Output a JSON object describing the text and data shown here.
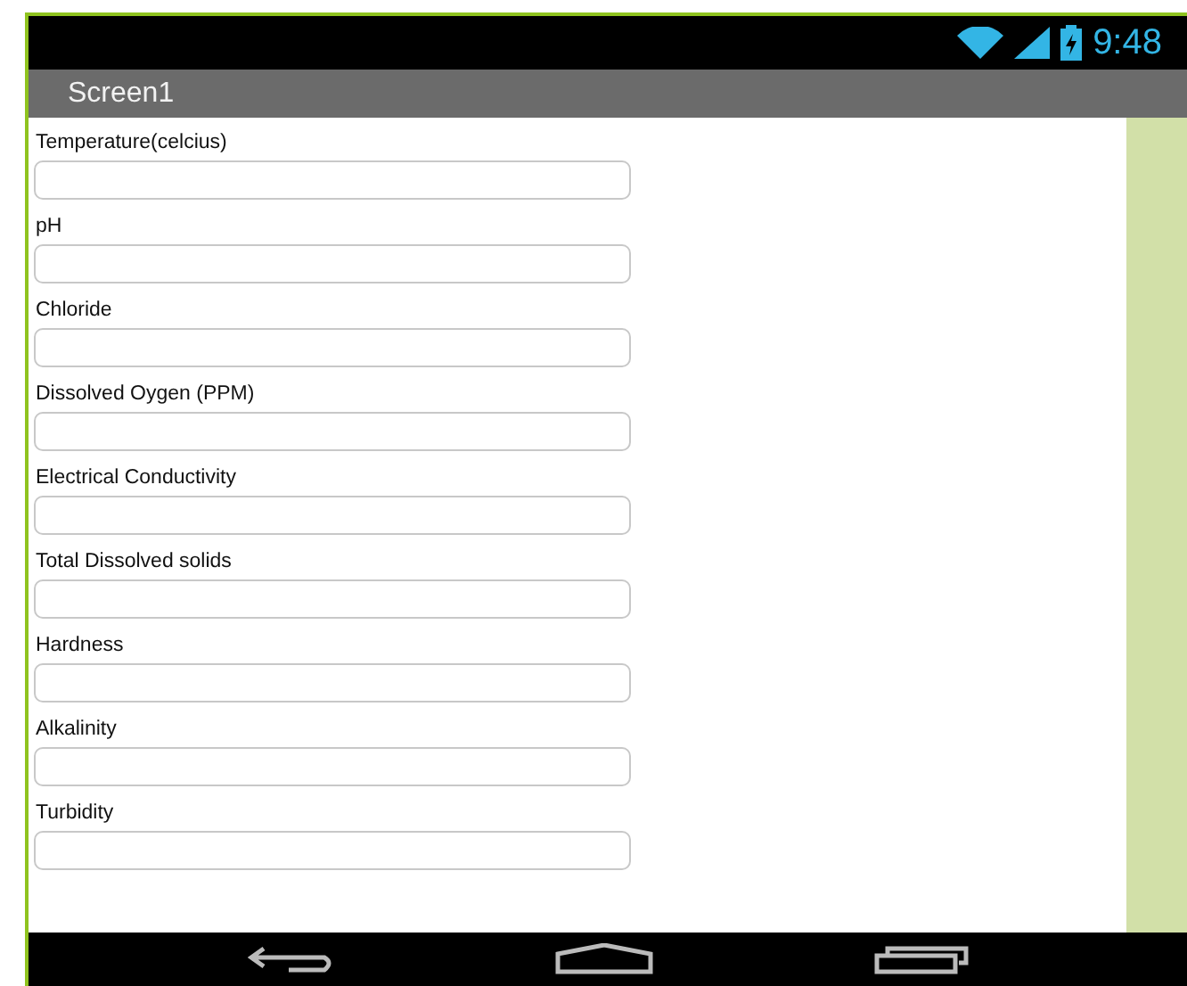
{
  "status_bar": {
    "time": "9:48"
  },
  "title_bar": {
    "title": "Screen1"
  },
  "fields": [
    {
      "label": "Temperature(celcius)"
    },
    {
      "label": "pH"
    },
    {
      "label": "Chloride"
    },
    {
      "label": "Dissolved Oygen (PPM)"
    },
    {
      "label": "Electrical Conductivity"
    },
    {
      "label": "Total Dissolved solids"
    },
    {
      "label": "Hardness"
    },
    {
      "label": "Alkalinity"
    },
    {
      "label": "Turbidity"
    }
  ]
}
